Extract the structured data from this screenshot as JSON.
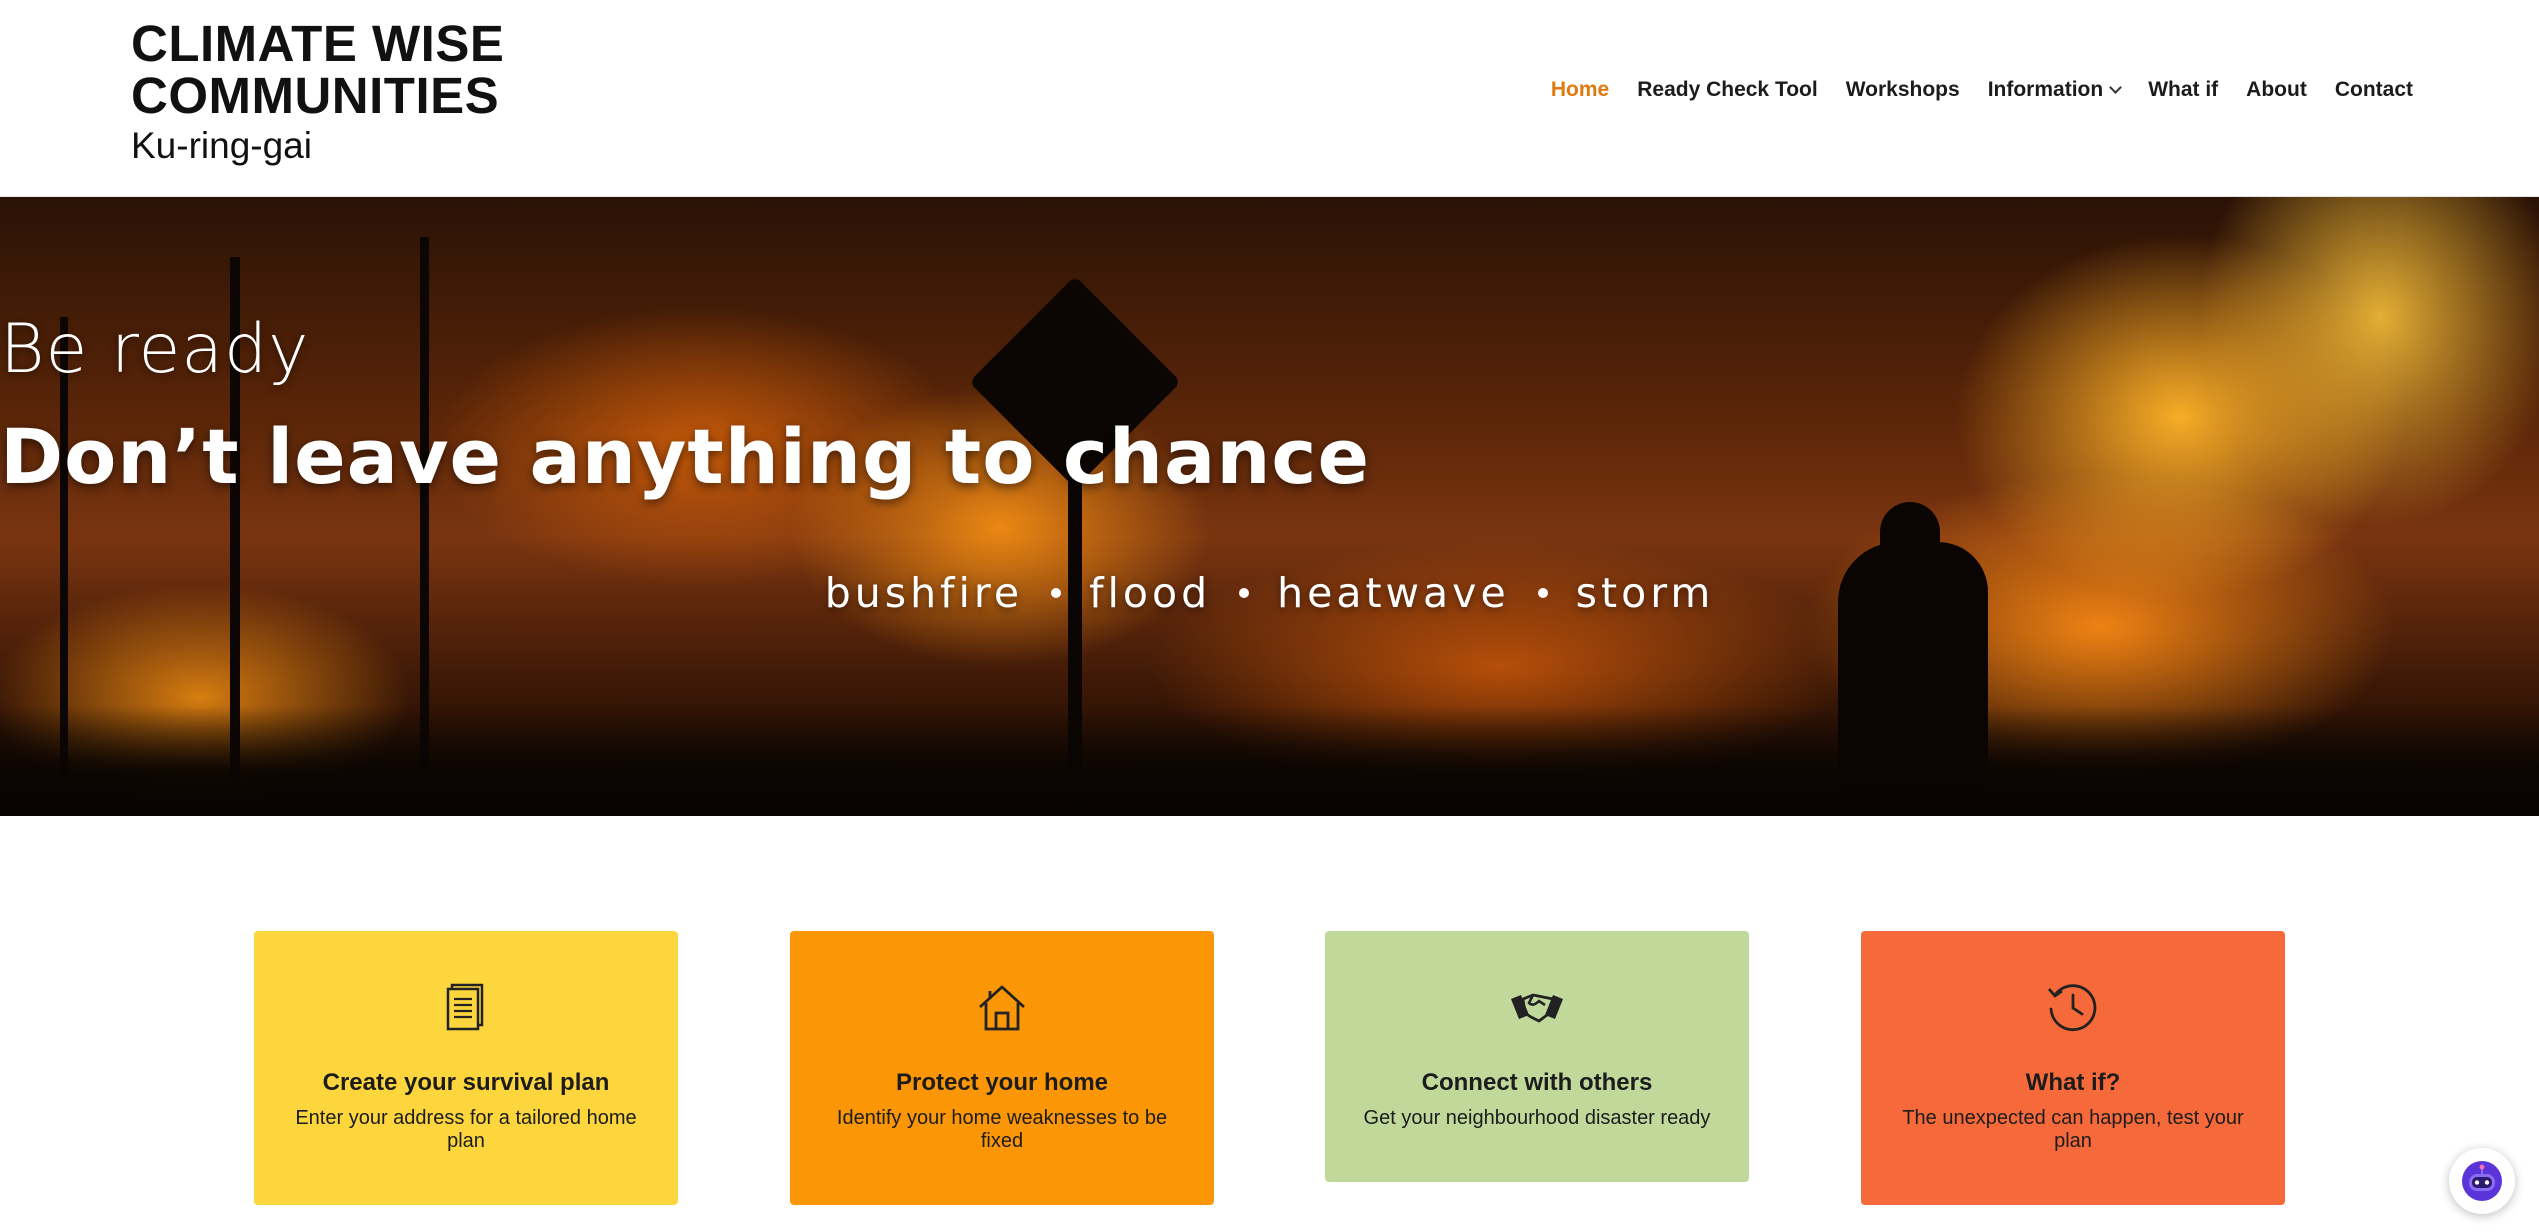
{
  "site": {
    "logo_line1": "CLIMATE WISE",
    "logo_line2": "COMMUNITIES",
    "logo_sub": "Ku-ring-gai"
  },
  "nav": {
    "items": [
      {
        "label": "Home",
        "active": true
      },
      {
        "label": "Ready Check Tool"
      },
      {
        "label": "Workshops"
      },
      {
        "label": "Information",
        "has_dropdown": true
      },
      {
        "label": "What if"
      },
      {
        "label": "About"
      },
      {
        "label": "Contact"
      }
    ],
    "active_color": "#e07a10"
  },
  "hero": {
    "kicker": "Be ready",
    "title": "Don’t leave anything to chance",
    "hazards": [
      "bushfire",
      "flood",
      "heatwave",
      "storm"
    ]
  },
  "cards": [
    {
      "icon": "document-icon",
      "title": "Create your survival plan",
      "desc": "Enter your address for a tailored home plan",
      "color": "#fdd63d"
    },
    {
      "icon": "house-icon",
      "title": "Protect your home",
      "desc": "Identify your home weaknesses to be fixed",
      "color": "#fb9706"
    },
    {
      "icon": "handshake-icon",
      "title": "Connect with others",
      "desc": "Get your neighbourhood disaster ready",
      "color": "#c1d89b"
    },
    {
      "icon": "history-clock-icon",
      "title": "What if?",
      "desc": "The unexpected can happen, test your plan",
      "color": "#f5693a"
    }
  ],
  "chat": {
    "icon": "chatbot-icon",
    "color": "#6c3ce0"
  }
}
